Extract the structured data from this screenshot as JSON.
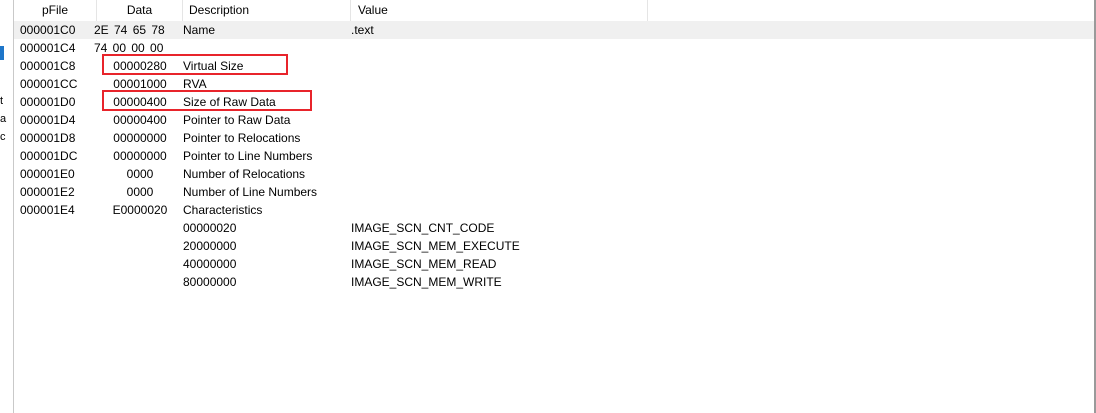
{
  "columns": {
    "pfile": "pFile",
    "data": "Data",
    "description": "Description",
    "value": "Value"
  },
  "rows": [
    {
      "pfile": "000001C0",
      "data": "2E  74  65  78",
      "description": "Name",
      "value": ".text",
      "bytes": true,
      "selected": true
    },
    {
      "pfile": "000001C4",
      "data": "74  00  00  00",
      "description": "",
      "value": "",
      "bytes": true
    },
    {
      "pfile": "000001C8",
      "data": "00000280",
      "description": "Virtual Size",
      "value": "",
      "highlighted": true
    },
    {
      "pfile": "000001CC",
      "data": "00001000",
      "description": "RVA",
      "value": ""
    },
    {
      "pfile": "000001D0",
      "data": "00000400",
      "description": "Size of Raw Data",
      "value": "",
      "highlighted": true
    },
    {
      "pfile": "000001D4",
      "data": "00000400",
      "description": "Pointer to Raw Data",
      "value": ""
    },
    {
      "pfile": "000001D8",
      "data": "00000000",
      "description": "Pointer to Relocations",
      "value": ""
    },
    {
      "pfile": "000001DC",
      "data": "00000000",
      "description": "Pointer to Line Numbers",
      "value": ""
    },
    {
      "pfile": "000001E0",
      "data": "0000",
      "description": "Number of Relocations",
      "value": ""
    },
    {
      "pfile": "000001E2",
      "data": "0000",
      "description": "Number of Line Numbers",
      "value": ""
    },
    {
      "pfile": "000001E4",
      "data": "E0000020",
      "description": "Characteristics",
      "value": ""
    },
    {
      "pfile": "",
      "data": "",
      "description": "00000020",
      "value": "IMAGE_SCN_CNT_CODE"
    },
    {
      "pfile": "",
      "data": "",
      "description": "20000000",
      "value": "IMAGE_SCN_MEM_EXECUTE"
    },
    {
      "pfile": "",
      "data": "",
      "description": "40000000",
      "value": "IMAGE_SCN_MEM_READ"
    },
    {
      "pfile": "",
      "data": "",
      "description": "80000000",
      "value": "IMAGE_SCN_MEM_WRITE"
    }
  ],
  "left_strip_glyphs": [
    "t",
    "a",
    "c"
  ],
  "colors": {
    "highlight_box": "#e8242b",
    "selected_row": "#f0f0f0",
    "left_accent": "#1e76c9"
  }
}
